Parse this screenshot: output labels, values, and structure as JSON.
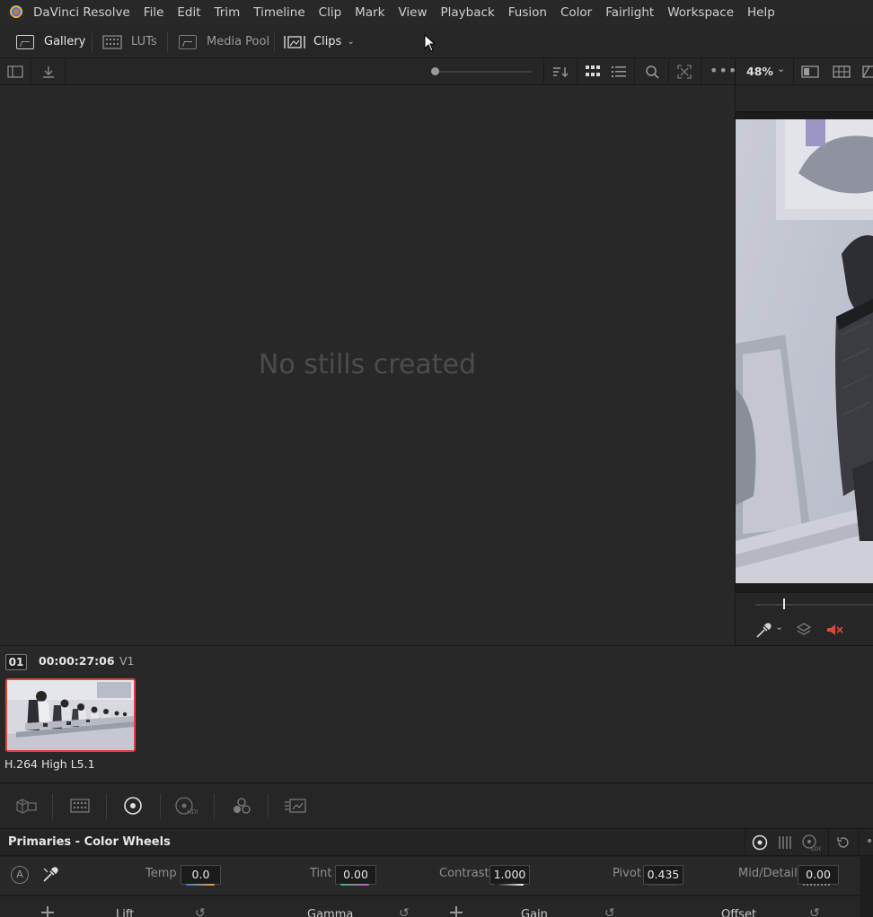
{
  "menubar": {
    "app_name": "DaVinci Resolve",
    "items": [
      "File",
      "Edit",
      "Trim",
      "Timeline",
      "Clip",
      "Mark",
      "View",
      "Playback",
      "Fusion",
      "Color",
      "Fairlight",
      "Workspace",
      "Help"
    ]
  },
  "toolbar": {
    "gallery": "Gallery",
    "luts": "LUTs",
    "media_pool": "Media Pool",
    "clips": "Clips"
  },
  "gallery": {
    "empty_message": "No stills created"
  },
  "viewer": {
    "zoom": "48%"
  },
  "clip": {
    "index": "01",
    "timecode": "00:00:27:06",
    "track": "V1",
    "codec": "H.264 High L5.1"
  },
  "primaries": {
    "title": "Primaries - Color Wheels",
    "auto_label": "A",
    "params": {
      "temp_label": "Temp",
      "temp_value": "0.0",
      "tint_label": "Tint",
      "tint_value": "0.00",
      "contrast_label": "Contrast",
      "contrast_value": "1.000",
      "pivot_label": "Pivot",
      "pivot_value": "0.435",
      "mid_detail_label": "Mid/Detail",
      "mid_detail_value": "0.00"
    },
    "wheels": {
      "lift": "Lift",
      "gamma": "Gamma",
      "gain": "Gain",
      "offset": "Offset"
    }
  },
  "colors": {
    "accent_red": "#d9483a",
    "mute_red": "#e0463a"
  }
}
